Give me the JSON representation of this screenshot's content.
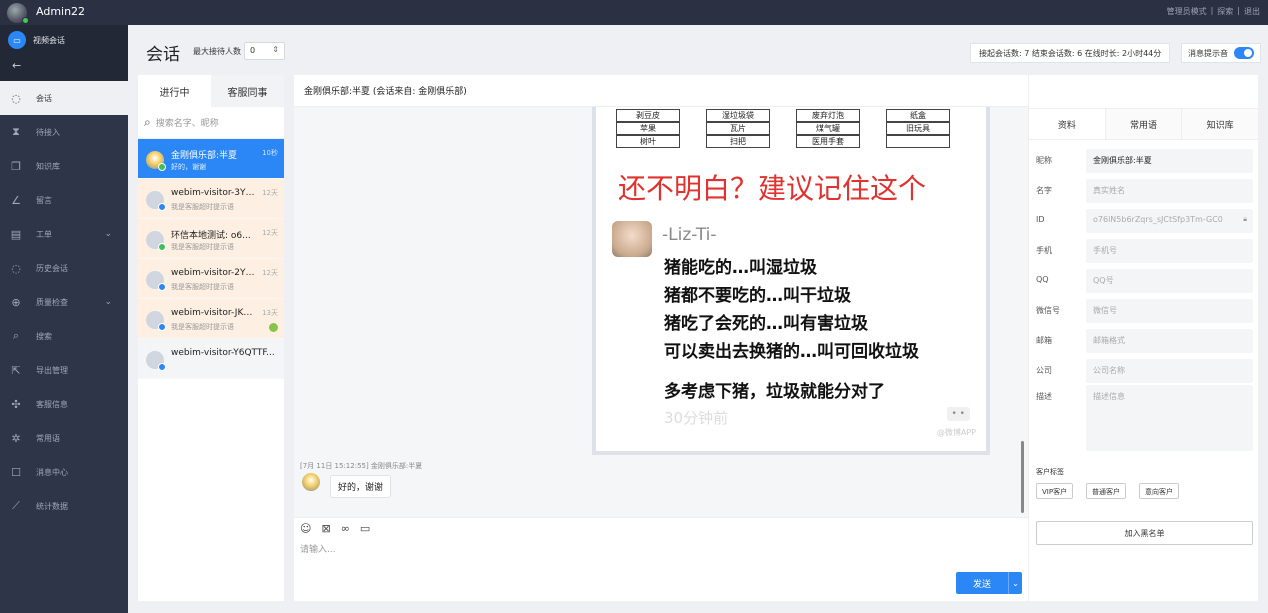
{
  "topbar": {
    "username": "Admin22",
    "links": [
      "管理员模式",
      "|",
      "探索",
      "|",
      "退出"
    ]
  },
  "sidebar": {
    "video_label": "视频会话",
    "back_icon": "←",
    "items": [
      {
        "label": "会话",
        "icon": "chat-icon",
        "glyph": "◌"
      },
      {
        "label": "待接入",
        "icon": "hourglass-icon",
        "glyph": "⧗"
      },
      {
        "label": "知识库",
        "icon": "book-icon",
        "glyph": "❐"
      },
      {
        "label": "留言",
        "icon": "edit-icon",
        "glyph": "∠"
      },
      {
        "label": "工单",
        "icon": "document-icon",
        "glyph": "▤",
        "arrow": "⌄"
      },
      {
        "label": "历史会话",
        "icon": "history-icon",
        "glyph": "◌"
      },
      {
        "label": "质量检查",
        "icon": "plus-circle-icon",
        "glyph": "⊕",
        "arrow": "⌄"
      },
      {
        "label": "搜索",
        "icon": "search-icon",
        "glyph": "⌕"
      },
      {
        "label": "导出管理",
        "icon": "export-icon",
        "glyph": "⇱"
      },
      {
        "label": "客服信息",
        "icon": "settings-icon",
        "glyph": "✣"
      },
      {
        "label": "常用语",
        "icon": "sun-icon",
        "glyph": "✲"
      },
      {
        "label": "消息中心",
        "icon": "message-icon",
        "glyph": "☐"
      },
      {
        "label": "统计数据",
        "icon": "chart-icon",
        "glyph": "⟋"
      }
    ]
  },
  "header": {
    "title": "会话",
    "max_label": "最大接待人数",
    "max_value": "0",
    "stats": "接起会话数: 7  结束会话数: 6  在线时长: 2小时44分",
    "notify_label": "消息提示音"
  },
  "list": {
    "tabs": [
      "进行中",
      "客服同事"
    ],
    "search_placeholder": "搜索名字、昵称",
    "conversations": [
      {
        "name": "金刚俱乐部:半夏",
        "time": "10秒",
        "msg": "好的，谢谢"
      },
      {
        "name": "webim-visitor-3YT2...",
        "time": "12天",
        "msg": "我是客服超时提示语"
      },
      {
        "name": "环信本地测试: o6...",
        "time": "12天",
        "msg": "我是客服超时提示语"
      },
      {
        "name": "webim-visitor-2YM...",
        "time": "12天",
        "msg": "我是客服超时提示语"
      },
      {
        "name": "webim-visitor-JKE6...",
        "time": "13天",
        "msg": "我是客服超时提示语"
      },
      {
        "name": "webim-visitor-Y6QTTF...",
        "time": "",
        "msg": ""
      }
    ]
  },
  "chat": {
    "header": "金刚俱乐部:半夏 (会话来自: 金刚俱乐部)",
    "meme": {
      "rows": [
        [
          "剥豆皮",
          "湿垃圾袋",
          "废弃灯泡",
          "纸盒"
        ],
        [
          "苹果",
          "瓦片",
          "煤气罐",
          "旧玩具"
        ],
        [
          "树叶",
          "扫把",
          "医用手套",
          ""
        ]
      ],
      "headline": "还不明白？建议记住这个",
      "author": "-Liz-Ti-",
      "lines": [
        "猪能吃的…叫湿垃圾",
        "猪都不要吃的…叫干垃圾",
        "猪吃了会死的…叫有害垃圾",
        "可以卖出去换猪的…叫可回收垃圾",
        "多考虑下猪，垃圾就能分对了"
      ],
      "ago": "30分钟前",
      "dots": "• •",
      "watermark": "@微博APP"
    },
    "message_meta": "[7月 11日 15:12:55] 金刚俱乐部:半夏",
    "message_text": "好的，谢谢",
    "input_placeholder": "请输入...",
    "send_label": "发送"
  },
  "info": {
    "tabs": [
      "资料",
      "常用语",
      "知识库"
    ],
    "fields": [
      {
        "label": "昵称",
        "value": "金刚俱乐部:半夏",
        "filled": true
      },
      {
        "label": "名字",
        "value": "真实姓名"
      },
      {
        "label": "ID",
        "value": "o76lN5b6rZqrs_sJCtSfp3Tm-GC0"
      },
      {
        "label": "手机",
        "value": "手机号"
      },
      {
        "label": "QQ",
        "value": "QQ号"
      },
      {
        "label": "微信号",
        "value": "微信号"
      },
      {
        "label": "邮箱",
        "value": "邮箱格式"
      },
      {
        "label": "公司",
        "value": "公司名称"
      }
    ],
    "desc_label": "描述",
    "desc_placeholder": "描述信息",
    "tags_label": "客户标签",
    "tags": [
      "VIP客户",
      "普通客户",
      "意向客户"
    ],
    "blacklist_label": "加入黑名单"
  },
  "colors": {
    "accent": "#2b87f5",
    "sidebar": "#2f3548",
    "topbar": "#2b3143"
  }
}
